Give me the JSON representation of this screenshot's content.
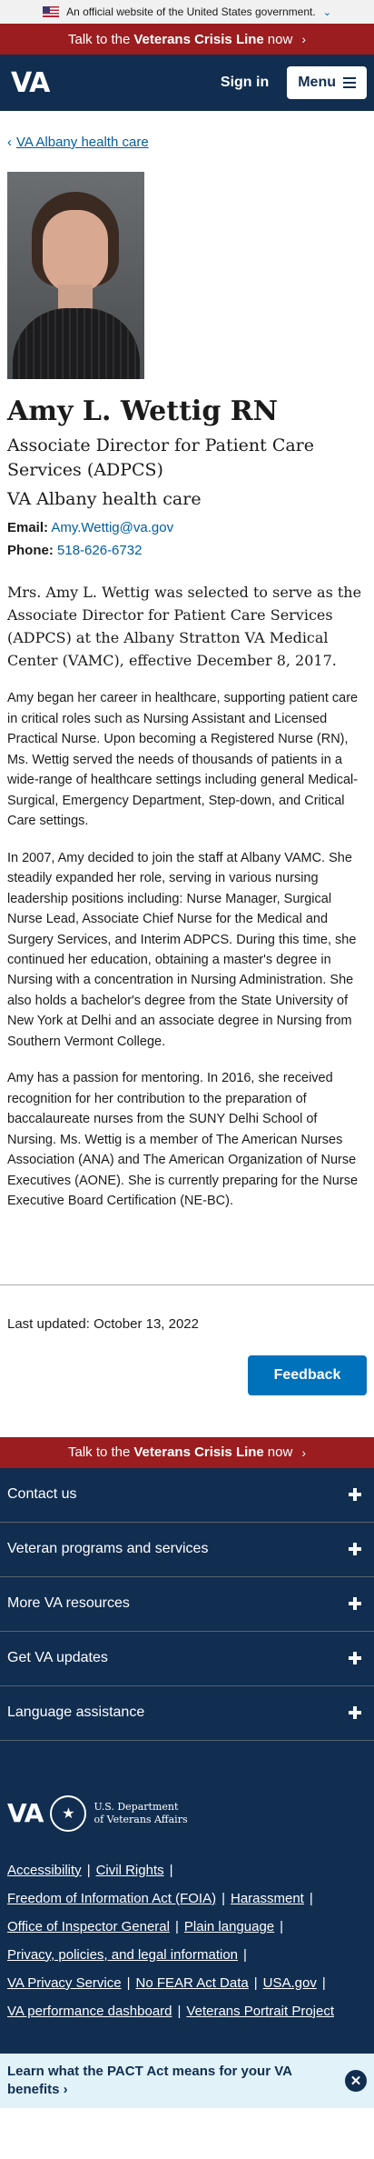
{
  "gov_banner": {
    "text": "An official website of the United States government."
  },
  "crisis": {
    "prefix": "Talk to the",
    "bold": "Veterans Crisis Line",
    "suffix": "now"
  },
  "header": {
    "logo": "VA",
    "signin": "Sign in",
    "menu": "Menu"
  },
  "breadcrumb": {
    "label": "VA Albany health care"
  },
  "profile": {
    "name": "Amy L. Wettig RN",
    "role": "Associate Director for Patient Care Services (ADPCS)",
    "facility": "VA Albany health care",
    "email_label": "Email:",
    "email": "Amy.Wettig@va.gov",
    "phone_label": "Phone:",
    "phone": "518-626-6732"
  },
  "bio": {
    "lead": "Mrs. Amy L. Wettig was selected to serve as the Associate Director for Patient Care Services (ADPCS) at the Albany Stratton VA Medical Center (VAMC), effective December 8, 2017.",
    "p1": "Amy began her career in healthcare, supporting patient care in critical roles such as Nursing Assistant and Licensed Practical Nurse. Upon becoming a Registered Nurse (RN), Ms. Wettig served the needs of thousands of patients in a wide-range of healthcare settings including general Medical-Surgical, Emergency Department, Step-down, and Critical Care settings.",
    "p2": "In 2007, Amy decided to join the staff at Albany VAMC. She steadily expanded her role, serving in various nursing leadership positions including: Nurse Manager, Surgical Nurse Lead, Associate Chief Nurse for the Medical and Surgery Services, and Interim ADPCS. During this time, she continued her education, obtaining a master's degree in Nursing with a concentration in Nursing Administration. She also holds a bachelor's degree from the State University of New York at Delhi and an associate degree in Nursing from Southern Vermont College.",
    "p3": "Amy has a passion for mentoring. In 2016, she received recognition for her contribution to the preparation of baccalaureate nurses from the SUNY Delhi School of Nursing. Ms. Wettig is a member of The American Nurses Association (ANA) and The American Organization of Nurse Executives (AONE). She is currently preparing for the Nurse Executive Board Certification (NE-BC)."
  },
  "last_updated": "Last updated: October 13, 2022",
  "feedback": "Feedback",
  "footer": {
    "accordion": [
      "Contact us",
      "Veteran programs and services",
      "More VA resources",
      "Get VA updates",
      "Language assistance"
    ],
    "brand_va": "VA",
    "dept_line1": "U.S. Department",
    "dept_line2": "of Veterans Affairs",
    "links": {
      "accessibility": "Accessibility",
      "civil_rights": "Civil Rights",
      "foia": "Freedom of Information Act (FOIA)",
      "harassment": "Harassment",
      "oig": "Office of Inspector General",
      "plain_language": "Plain language",
      "privacy": "Privacy, policies, and legal information",
      "va_privacy": "VA Privacy Service",
      "no_fear": "No FEAR Act Data",
      "usa_gov": "USA.gov",
      "performance": "VA performance dashboard",
      "portrait": "Veterans Portrait Project"
    }
  },
  "pact": {
    "text": "Learn what the PACT Act means for your VA benefits"
  },
  "colors": {
    "navy": "#112e51",
    "crisis_red": "#9b1d1f",
    "link_blue": "#005ea2",
    "button_blue": "#0071bb"
  }
}
